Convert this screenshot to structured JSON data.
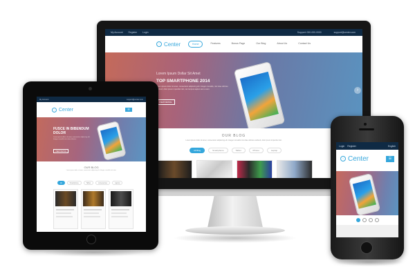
{
  "monitor": {
    "topbar": {
      "left1": "My Account",
      "left2": "Register",
      "left3": "Login",
      "right1": "Support: 000-000-0000",
      "right2": "support@center.com"
    },
    "logo": "Center",
    "menu": [
      "Home",
      "Features",
      "Bonus Page",
      "Our Blog",
      "About Us",
      "Contact Us"
    ],
    "hero": {
      "title": "Lorem Ipsum Dollar Sit Amet",
      "subtitle": "TOP SMARTPHONE 2014",
      "body": "Lorem ipsum dolor sit amet, consectetur adipiscing elit. Integer convallis, nisi vitae ultricies eleifend, dolor ipsum imperdiet nisl, nec tempus sapien sem a sem.",
      "button": "VIEW DETAIL"
    },
    "blog": {
      "title": "OUR BLOG",
      "subtitle": "Lorem ipsum dolor sit amet, consectetur adipiscing elit. Integer convallis nisi vitae ultricies eleifend, dolor ipsum imperdiet nisl.",
      "tabs": [
        "All Blog",
        "Smartphone",
        "Tablet",
        "iPhone",
        "Laptop"
      ]
    }
  },
  "tablet": {
    "topbar": {
      "left1": "My Account",
      "right1": "support@center.com"
    },
    "logo": "Center",
    "hero": {
      "title": "FUSCE IN BIBENDUM DOLOR",
      "body": "Lorem ipsum dolor sit amet, consectetur adipiscing elit. Integer convallis nisi vitae ultricies.",
      "button": "VIEW DETAIL"
    },
    "blog": {
      "title": "OUR BLOG",
      "subtitle": "Lorem ipsum dolor sit amet, consectetur adipiscing elit. Integer convallis nisi vitae.",
      "tabs": [
        "All",
        "Smartphone",
        "Tablet",
        "Accessories",
        "Laptop"
      ]
    }
  },
  "phone": {
    "topbar": {
      "login": "Login",
      "register": "Register",
      "language": "English"
    },
    "logo": "Center",
    "menu_icon": "☰"
  },
  "icons": {
    "logo_icon": "logo-circle-icon",
    "next_arrow": "›"
  },
  "colors": {
    "accent": "#35a7dc",
    "topbar": "#0f2a44"
  }
}
